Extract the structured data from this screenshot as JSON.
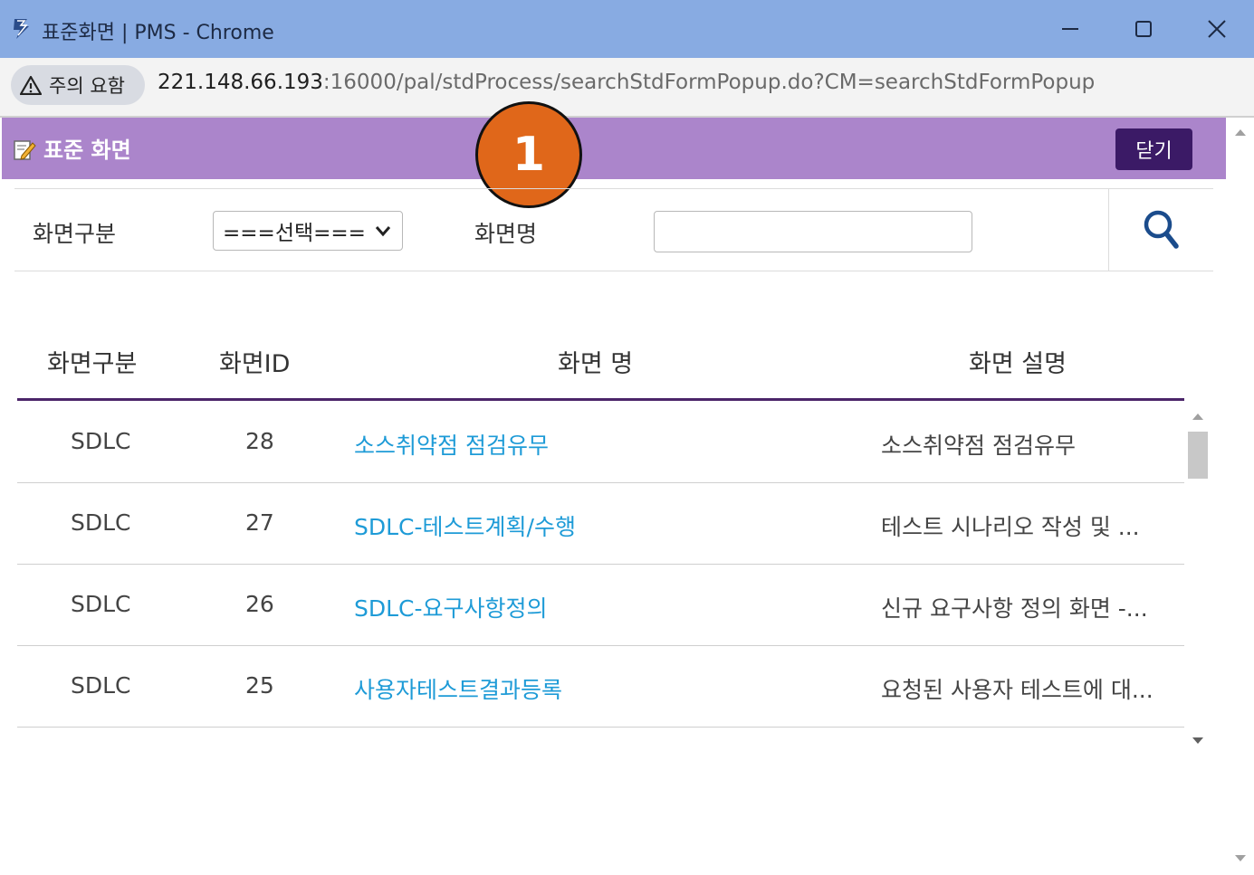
{
  "window": {
    "title": "표준화면 | PMS - Chrome",
    "minimize_icon": "minimize-icon",
    "maximize_icon": "maximize-icon",
    "close_icon": "close-icon"
  },
  "address_bar": {
    "warning_label": "주의 요함",
    "url_host": "221.148.66.193",
    "url_rest": ":16000/pal/stdProcess/searchStdFormPopup.do?CM=searchStdFormPopup"
  },
  "popup": {
    "title": "표준 화면",
    "close_label": "닫기",
    "step_badge": "1"
  },
  "search": {
    "type_label": "화면구분",
    "type_selected": "===선택===",
    "name_label": "화면명",
    "name_value": ""
  },
  "table": {
    "columns": [
      "화면구분",
      "화면ID",
      "화면 명",
      "화면 설명"
    ],
    "rows": [
      {
        "type": "SDLC",
        "id": "28",
        "name": "소스취약점 점검유무",
        "desc": "소스취약점 점검유무"
      },
      {
        "type": "SDLC",
        "id": "27",
        "name": "SDLC-테스트계획/수행",
        "desc": "테스트 시나리오 작성 및 ..."
      },
      {
        "type": "SDLC",
        "id": "26",
        "name": "SDLC-요구사항정의",
        "desc": "신규 요구사항 정의 화면 -..."
      },
      {
        "type": "SDLC",
        "id": "25",
        "name": "사용자테스트결과등록",
        "desc": "요청된 사용자 테스트에 대..."
      }
    ]
  },
  "colors": {
    "titlebar": "#88abe2",
    "header": "#ab85cb",
    "close_button": "#3b1a66",
    "badge": "#e0671a",
    "link": "#1e9bd7",
    "table_rule": "#4b2569"
  }
}
